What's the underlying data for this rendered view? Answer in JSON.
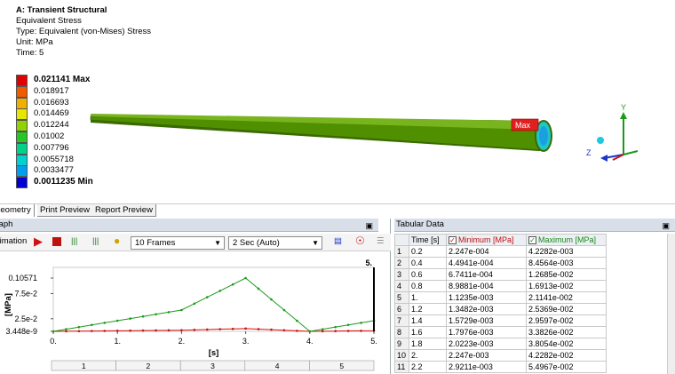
{
  "info": {
    "title": "A: Transient Structural",
    "line1": "Equivalent Stress",
    "line2": "Type: Equivalent (von-Mises) Stress",
    "line3": "Unit: MPa",
    "line4": "Time: 5"
  },
  "legend": [
    {
      "label": "0.021141 Max",
      "color": "#e00000",
      "bold": true
    },
    {
      "label": "0.018917",
      "color": "#f05a00"
    },
    {
      "label": "0.016693",
      "color": "#f0b000"
    },
    {
      "label": "0.014469",
      "color": "#e6e600"
    },
    {
      "label": "0.012244",
      "color": "#8fd400"
    },
    {
      "label": "0.01002",
      "color": "#26c826"
    },
    {
      "label": "0.007796",
      "color": "#00d28c"
    },
    {
      "label": "0.0055718",
      "color": "#00d2d2"
    },
    {
      "label": "0.0033477",
      "color": "#00a0f0"
    },
    {
      "label": "0.0011235 Min",
      "color": "#0000d2",
      "bold": true
    }
  ],
  "probe": {
    "label": "Max"
  },
  "triad": {
    "y": "Y",
    "z": "Z"
  },
  "tabs": [
    "Geometry",
    "Print Preview",
    "Report Preview"
  ],
  "graph": {
    "header": "Graph",
    "animation_label": "Animation",
    "frames": "10 Frames",
    "duration": "2 Sec (Auto)"
  },
  "tabular": {
    "header": "Tabular Data",
    "columns": [
      "Time [s]",
      "Minimum [MPa]",
      "Maximum [MPa]"
    ],
    "rows": [
      [
        "1",
        "0.2",
        "2.247e-004",
        "4.2282e-003"
      ],
      [
        "2",
        "0.4",
        "4.4941e-004",
        "8.4564e-003"
      ],
      [
        "3",
        "0.6",
        "6.7411e-004",
        "1.2685e-002"
      ],
      [
        "4",
        "0.8",
        "8.9881e-004",
        "1.6913e-002"
      ],
      [
        "5",
        "1.",
        "1.1235e-003",
        "2.1141e-002"
      ],
      [
        "6",
        "1.2",
        "1.3482e-003",
        "2.5369e-002"
      ],
      [
        "7",
        "1.4",
        "1.5729e-003",
        "2.9597e-002"
      ],
      [
        "8",
        "1.6",
        "1.7976e-003",
        "3.3826e-002"
      ],
      [
        "9",
        "1.8",
        "2.0223e-003",
        "3.8054e-002"
      ],
      [
        "10",
        "2.",
        "2.247e-003",
        "4.2282e-002"
      ],
      [
        "11",
        "2.2",
        "2.9211e-003",
        "5.4967e-002"
      ]
    ]
  },
  "chart_data": {
    "type": "line",
    "ylabel": "[MPa]",
    "xlabel": "[s]",
    "xlim": [
      0,
      5
    ],
    "ylim": [
      0,
      0.10571
    ],
    "x_ticks": [
      "0.",
      "1.",
      "2.",
      "3.",
      "4.",
      "5."
    ],
    "y_ticks": [
      {
        "label": "0.10571",
        "value": 0.10571
      },
      {
        "label": "7.5e-2",
        "value": 0.075
      },
      {
        "label": "2.5e-2",
        "value": 0.025
      },
      {
        "label": "3.448e-9",
        "value": 0
      }
    ],
    "current_time_label": "5.",
    "current_time": 5,
    "frame_labels": [
      "1",
      "2",
      "3",
      "4",
      "5"
    ],
    "series": [
      {
        "name": "Minimum [MPa]",
        "color": "#d01010",
        "x": [
          0,
          0.2,
          0.4,
          0.6,
          0.8,
          1.0,
          1.2,
          1.4,
          1.6,
          1.8,
          2.0,
          2.2,
          2.4,
          2.6,
          2.8,
          3.0,
          3.2,
          3.4,
          3.6,
          3.8,
          4.0,
          4.2,
          4.4,
          4.6,
          4.8,
          5.0
        ],
        "y": [
          0,
          0.000225,
          0.000449,
          0.000674,
          0.000899,
          0.001124,
          0.001348,
          0.001573,
          0.001798,
          0.002022,
          0.002247,
          0.002921,
          0.0036,
          0.0043,
          0.0049,
          0.0056,
          0.0045,
          0.0034,
          0.0022,
          0.0011,
          0.0,
          0.00025,
          0.0005,
          0.0008,
          0.001,
          0.0011
        ]
      },
      {
        "name": "Maximum [MPa]",
        "color": "#1a9a1a",
        "x": [
          0,
          0.2,
          0.4,
          0.6,
          0.8,
          1.0,
          1.2,
          1.4,
          1.6,
          1.8,
          2.0,
          2.2,
          2.4,
          2.6,
          2.8,
          3.0,
          3.2,
          3.4,
          3.6,
          3.8,
          4.0,
          4.2,
          4.4,
          4.6,
          4.8,
          5.0
        ],
        "y": [
          0,
          0.004228,
          0.008456,
          0.012685,
          0.016913,
          0.021141,
          0.025369,
          0.029597,
          0.033826,
          0.038054,
          0.042282,
          0.054967,
          0.0677,
          0.0803,
          0.093,
          0.10571,
          0.0846,
          0.0634,
          0.0423,
          0.0211,
          0.0,
          0.0042,
          0.0085,
          0.0127,
          0.0169,
          0.0211
        ]
      }
    ]
  }
}
